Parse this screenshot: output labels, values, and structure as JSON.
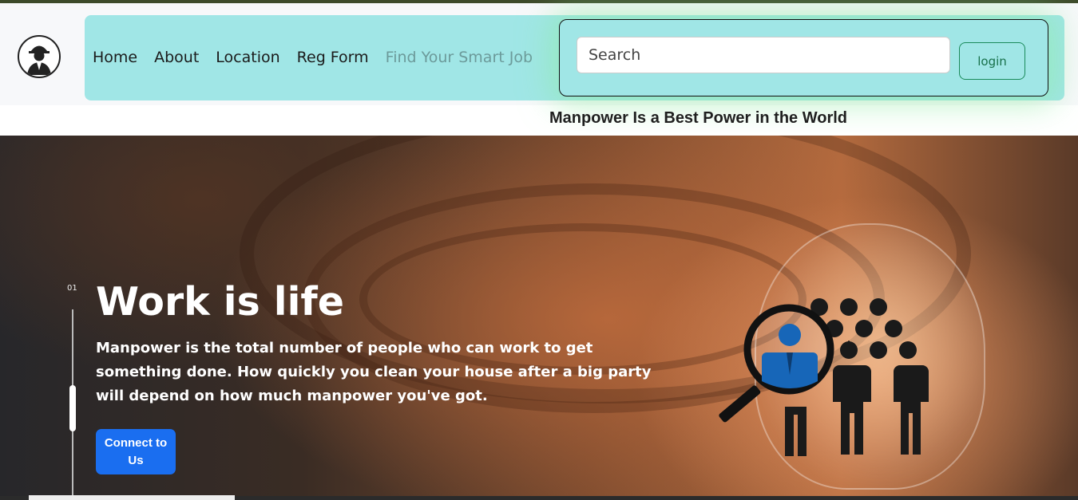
{
  "nav": {
    "links": [
      "Home",
      "About",
      "Location",
      "Reg Form",
      "Find Your Smart Job"
    ],
    "search_placeholder": "Search",
    "login_label": "login"
  },
  "tagline": "Manpower Is a Best Power in the World",
  "hero": {
    "slide_number": "01",
    "title": "Work is life",
    "description": "Manpower is the total number of people who can work to get something done. How quickly you clean your house after a big party will depend on how much manpower you've got.",
    "cta_label": "Connect to Us"
  },
  "colors": {
    "navbar_bg": "#a0e6e6",
    "cta_bg": "#1a6ef0",
    "login_border": "#1a8a5a"
  },
  "icons": {
    "logo": "worker-helmet-icon",
    "hero_graphic": "people-search-icon"
  }
}
